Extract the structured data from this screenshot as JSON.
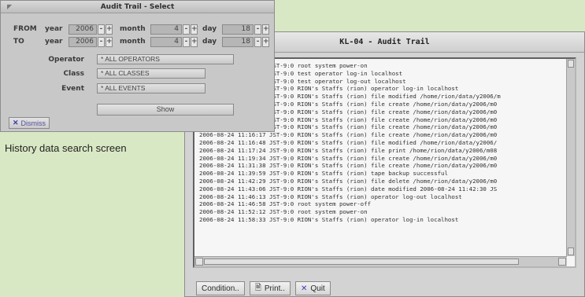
{
  "audit_window": {
    "title": "KL-04 - Audit Trail",
    "log_lines": [
      "2006-08-24 11:02:39 JST-9:0 root system power-on",
      "2006-08-24 11:02:59 JST-9:0 test operator log-in localhost",
      "2006-08-24 11:03:13 JST-9:0 test operator log-out localhost",
      "2006-08-24 11:03:33 JST-9:0 RION's Staffs (rion) operator log-in localhost",
      "2006-08-24 11:05:46 JST-9:0 RION's Staffs (rion) file modified /home/rion/data/y2006/m",
      "2006-08-24 11:06:24 JST-9:0 RION's Staffs (rion) file create /home/rion/data/y2006/m0",
      "2006-08-24 11:07:46 JST-9:0 RION's Staffs (rion) file create /home/rion/data/y2006/m0",
      "2006-08-24 11:09:01 JST-9:0 RION's Staffs (rion) file create /home/rion/data/y2006/m0",
      "2006-08-24 11:14:38 JST-9:0 RION's Staffs (rion) file create /home/rion/data/y2006/m0",
      "2006-08-24 11:16:17 JST-9:0 RION's Staffs (rion) file create /home/rion/data/y2006/m0",
      "2006-08-24 11:16:48 JST-9:0 RION's Staffs (rion) file modified /home/rion/data/y2006/",
      "2006-08-24 11:17:24 JST-9:0 RION's Staffs (rion) file print /home/rion/data/y2006/m08",
      "2006-08-24 11:19:34 JST-9:0 RION's Staffs (rion) file create /home/rion/data/y2006/m0",
      "2006-08-24 11:31:38 JST-9:0 RION's Staffs (rion) file create /home/rion/data/y2006/m0",
      "2006-08-24 11:39:59 JST-9:0 RION's Staffs (rion) tape backup successful",
      "2006-08-24 11:42:29 JST-9:0 RION's Staffs (rion) file delete /home/rion/data/y2006/m0",
      "2006-08-24 11:43:06 JST-9:0 RION's Staffs (rion) date modified 2006-08-24 11:42:30 JS",
      "2006-08-24 11:46:13 JST-9:0 RION's Staffs (rion) operator log-out localhost",
      "2006-08-24 11:46:58 JST-9:0 root system power-off",
      "2006-08-24 11:52:12 JST-9:0 root system power-on",
      "2006-08-24 11:58:33 JST-9:0 RION's Staffs (rion) operator log-in localhost"
    ],
    "buttons": {
      "condition": "Condition..",
      "print": "Print..",
      "quit": "Quit"
    }
  },
  "select_window": {
    "title": "Audit Trail - Select",
    "from_label": "FROM",
    "to_label": "TO",
    "year_label": "year",
    "month_label": "month",
    "day_label": "day",
    "from": {
      "year": "2006",
      "month": "4",
      "day": "18"
    },
    "to": {
      "year": "2006",
      "month": "4",
      "day": "18"
    },
    "spin_minus": "-",
    "spin_plus": "+",
    "operator_label": "Operator",
    "operator_value": "* ALL OPERATORS",
    "class_label": "Class",
    "class_value": "* ALL CLASSES",
    "event_label": "Event",
    "event_value": "* ALL EVENTS",
    "show_label": "Show",
    "dismiss_label": "Dismiss"
  },
  "caption": "History data search screen",
  "icons": {
    "window": "window-menu-icon",
    "print": "document-icon",
    "quit": "x-icon",
    "dismiss": "x-icon"
  }
}
